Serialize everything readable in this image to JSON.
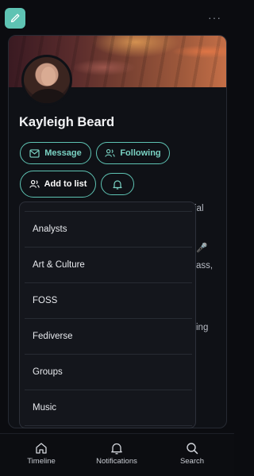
{
  "header": {
    "compose_icon": "pencil-icon",
    "more_icon": "more-dots-icon",
    "more_label": "···"
  },
  "profile": {
    "name": "Kayleigh Beard",
    "buttons": {
      "message": "Message",
      "following": "Following",
      "add_to_list": "Add to list"
    },
    "bio_fragments": [
      "ial",
      "🎤",
      "ass,",
      "ing"
    ]
  },
  "lists_dropdown": {
    "items": [
      "Analysts",
      "Art & Culture",
      "FOSS",
      "Fediverse",
      "Groups",
      "Music"
    ]
  },
  "bottom_nav": {
    "items": [
      {
        "label": "Timeline",
        "icon": "home-icon"
      },
      {
        "label": "Notifications",
        "icon": "bell-icon"
      },
      {
        "label": "Search",
        "icon": "search-icon"
      }
    ]
  },
  "colors": {
    "accent": "#5ec3b3",
    "background": "#0b0c10",
    "card": "#0f1116",
    "dropdown": "#14161c"
  }
}
